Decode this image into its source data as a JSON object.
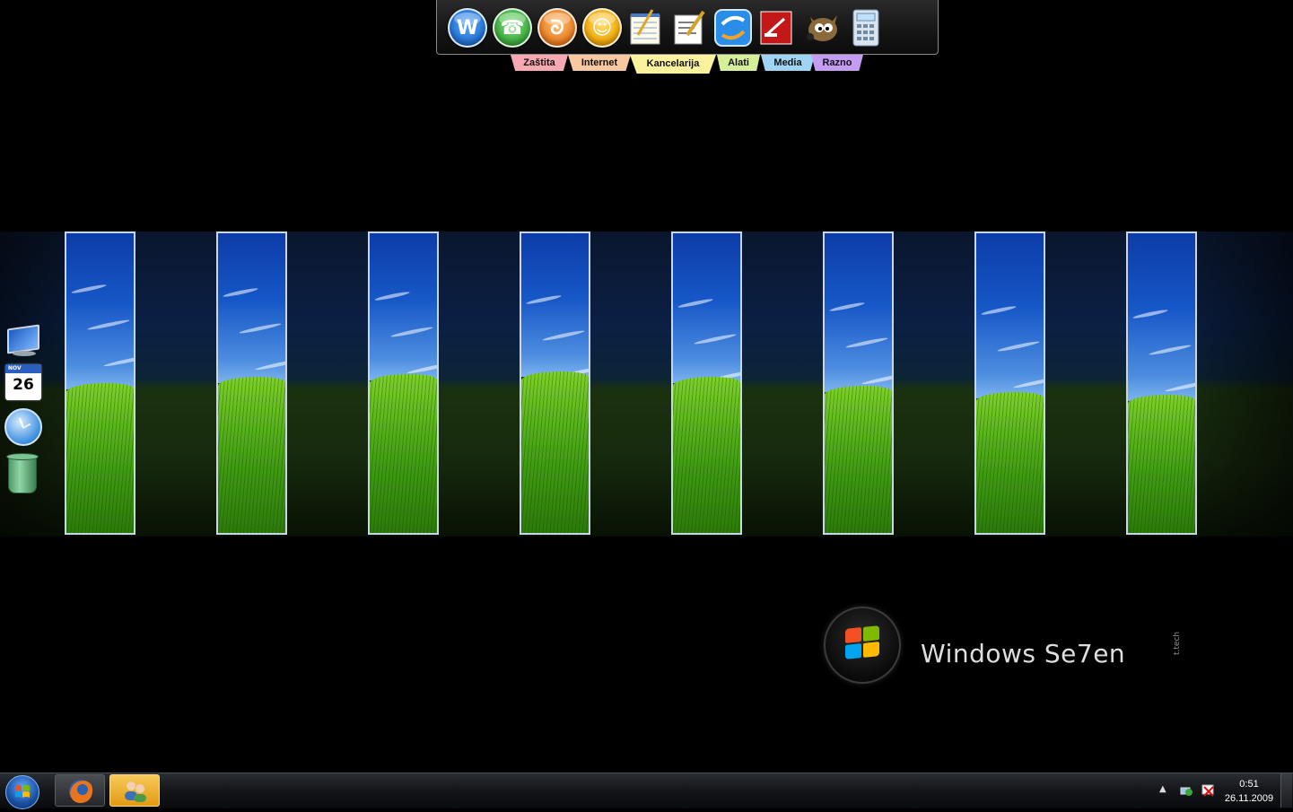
{
  "dock": {
    "icons": [
      {
        "name": "wunderlist-style-icon",
        "glyph": "W",
        "color": "#1f6fd0"
      },
      {
        "name": "phone-app-icon",
        "glyph": "☎",
        "color": "#3aa83a"
      },
      {
        "name": "orange-app-icon",
        "glyph": "ᘐ",
        "color": "#e8791b"
      },
      {
        "name": "smiley-app-icon",
        "glyph": "☺",
        "color": "#f0a400"
      },
      {
        "name": "notepad-icon"
      },
      {
        "name": "wordpad-icon"
      },
      {
        "name": "sync-app-icon"
      },
      {
        "name": "pdf-app-icon"
      },
      {
        "name": "gimp-icon"
      },
      {
        "name": "calculator-icon"
      }
    ],
    "tabs": [
      {
        "label": "Zaštita",
        "color": "#f7a9b3"
      },
      {
        "label": "Internet",
        "color": "#f8c8a0"
      },
      {
        "label": "Kancelarija",
        "color": "#fbf2a0"
      },
      {
        "label": "Alati",
        "color": "#d6ef9a"
      },
      {
        "label": "Media",
        "color": "#9fd4f5"
      },
      {
        "label": "Razno",
        "color": "#c49cf2"
      }
    ]
  },
  "gadgets": {
    "calendar_month": "NOV",
    "calendar_day": "26"
  },
  "brand": {
    "text": "Windows Se7en",
    "suffix": "t.tech"
  },
  "taskbar": {
    "time": "0:51",
    "date": "26.11.2009",
    "tray_arrow": "▲"
  },
  "colors": {
    "flag_red": "#f25022",
    "flag_green": "#7fba00",
    "flag_blue": "#00a4ef",
    "flag_yellow": "#ffb900"
  }
}
